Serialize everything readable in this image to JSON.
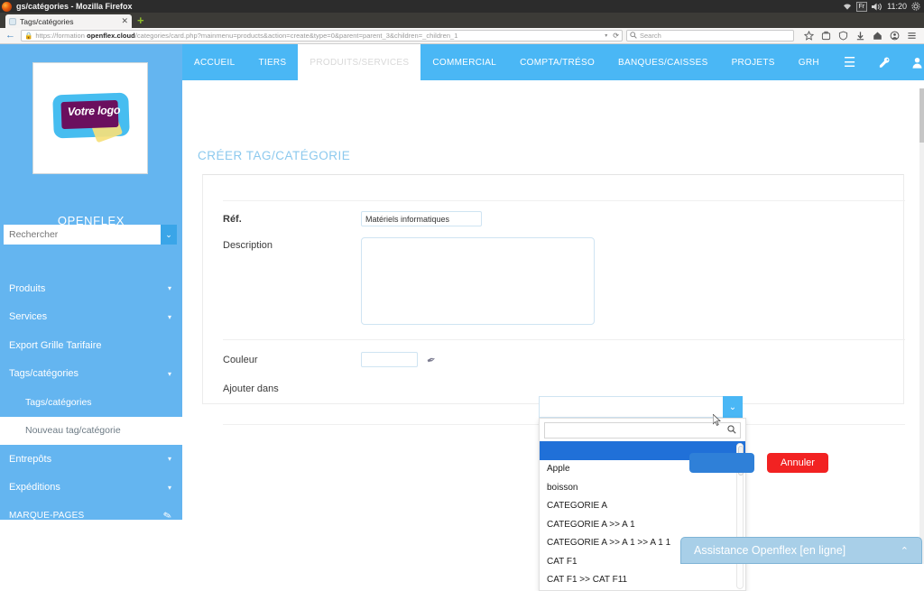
{
  "os_panel": {
    "window_title": "gs/catégories - Mozilla Firefox",
    "keyboard_layout": "Fr",
    "clock": "11:20",
    "icons": [
      "wifi-icon",
      "keyboard-layout-icon",
      "volume-icon",
      "settings-gear-icon"
    ]
  },
  "browser": {
    "tab": {
      "title": "Tags/catégories",
      "close_label": "✕",
      "new_tab_label": "+"
    },
    "back_label": "←",
    "url_prefix": "https://formation ",
    "url_domain": "openflex.cloud",
    "url_path": "/categories/card.php?mainmenu=products&action=create&type=0&parent=parent_3&children=_children_1",
    "url_dropdown_label": "▾",
    "reload_label": "⟳",
    "search": {
      "placeholder": "Search",
      "icon": "search-icon"
    },
    "toolbar_icons": [
      "bookmark-star-icon",
      "pocket-icon",
      "shield-icon",
      "download-icon",
      "home-icon",
      "account-icon",
      "hamburger-menu-icon"
    ]
  },
  "sidebar": {
    "logo_text": "Votre logo",
    "brand": "OPENFLEX",
    "search_placeholder": "Rechercher",
    "search_value": "",
    "search_dropdown_label": "⌄",
    "items": [
      {
        "label": "Produits",
        "caret": "▾",
        "type": "parent"
      },
      {
        "label": "Services",
        "caret": "▾",
        "type": "parent"
      },
      {
        "label": "Export Grille Tarifaire",
        "caret": "",
        "type": "plain"
      },
      {
        "label": "Tags/catégories",
        "caret": "▾",
        "type": "parent"
      },
      {
        "label": "Tags/catégories",
        "caret": "",
        "type": "child"
      },
      {
        "label": "Nouveau tag/catégorie",
        "caret": "",
        "type": "child-active"
      },
      {
        "label": "Entrepôts",
        "caret": "▾",
        "type": "parent"
      },
      {
        "label": "Expéditions",
        "caret": "▾",
        "type": "parent"
      },
      {
        "label": "MARQUE-PAGES",
        "caret": "",
        "type": "bookmarks",
        "icon": "pencil-icon"
      }
    ]
  },
  "topnav": {
    "items": [
      {
        "label": "ACCUEIL",
        "selected": false
      },
      {
        "label": "TIERS",
        "selected": false
      },
      {
        "label": "PRODUITS/SERVICES",
        "selected": true
      },
      {
        "label": "COMMERCIAL",
        "selected": false
      },
      {
        "label": "COMPTA/TRÉSO",
        "selected": false
      },
      {
        "label": "BANQUES/CAISSES",
        "selected": false
      },
      {
        "label": "PROJETS",
        "selected": false
      },
      {
        "label": "GRH",
        "selected": false
      }
    ],
    "burger_label": "☰",
    "right_icons": [
      "tools-icon",
      "user-icon",
      "printer-icon",
      "power-icon"
    ]
  },
  "main": {
    "page_title": "CRÉER TAG/CATÉGORIE",
    "fields": {
      "ref_label": "Réf.",
      "ref_value": "Matériels informatiques",
      "description_label": "Description",
      "description_value": "",
      "couleur_label": "Couleur",
      "couleur_value": "",
      "couleur_picker_icon": "color-picker-icon",
      "ajouter_dans_label": "Ajouter dans",
      "ajouter_dans_value": ""
    },
    "dropdown": {
      "open": true,
      "search_value": "",
      "search_icon": "search-icon",
      "arrow_label": "⌄",
      "options": [
        {
          "label": "",
          "highlighted": true
        },
        {
          "label": "Apple",
          "highlighted": false
        },
        {
          "label": "boisson",
          "highlighted": false
        },
        {
          "label": "CATEGORIE A",
          "highlighted": false
        },
        {
          "label": "CATEGORIE A >> A 1",
          "highlighted": false
        },
        {
          "label": "CATEGORIE A >> A 1 >> A 1 1",
          "highlighted": false
        },
        {
          "label": "CAT F1",
          "highlighted": false
        },
        {
          "label": "CAT F1 >> CAT F11",
          "highlighted": false
        }
      ]
    },
    "buttons": {
      "save_label": "",
      "cancel_label": "Annuler"
    }
  },
  "assistance": {
    "label": "Assistance Openflex [en ligne]",
    "chevron": "⌃"
  },
  "colors": {
    "accent_blue": "#4ab7f5",
    "sidebar_blue": "#64b5f0",
    "highlight_blue": "#2070d8",
    "cancel_red": "#f22222",
    "save_blue": "#2f80d8",
    "assist_blue": "#a8cfe8",
    "title_blue": "#8cc9ee"
  }
}
